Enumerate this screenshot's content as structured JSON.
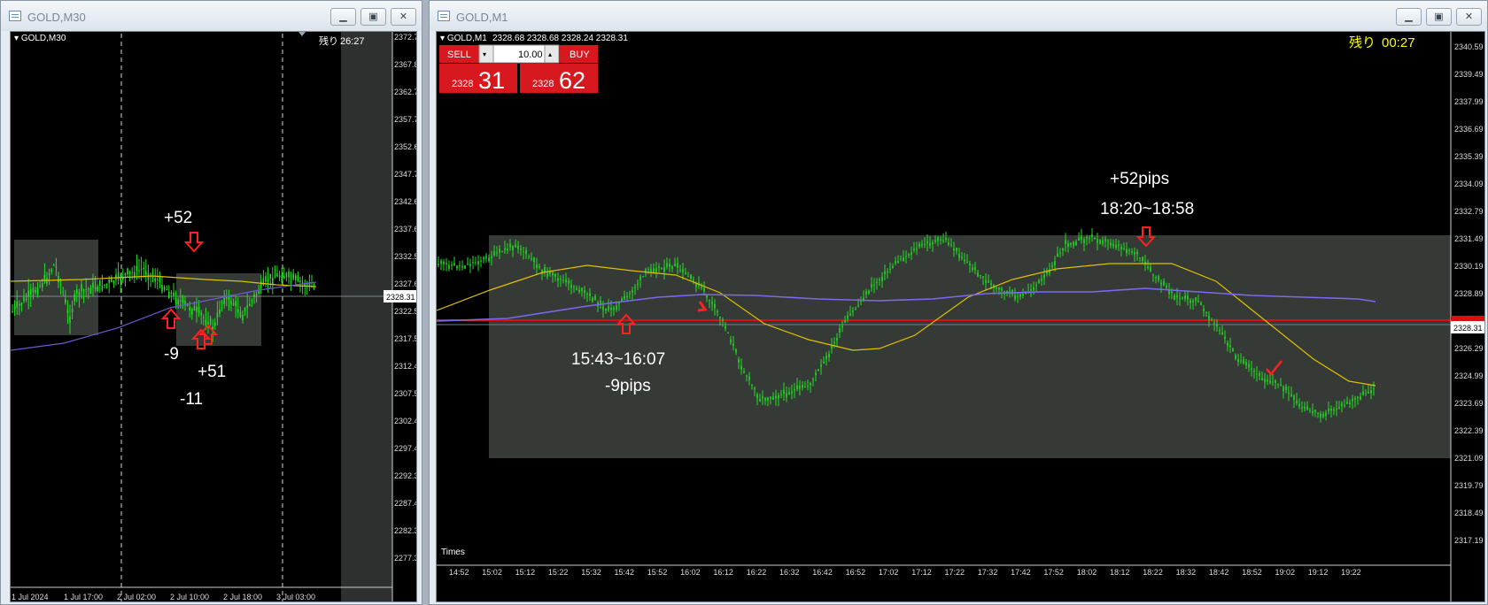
{
  "left": {
    "window_title": "GOLD,M30",
    "header_label": "GOLD,M30",
    "remain_label": "残り",
    "remain_time": "26:27",
    "price_labels": [
      "2372.78",
      "2367.83",
      "2362.73",
      "2357.78",
      "2352.68",
      "2347.73",
      "2342.63",
      "2337.68",
      "2332.58",
      "2327.63",
      "2322.53",
      "2317.58",
      "2312.48",
      "2307.53",
      "2302.43",
      "2297.48",
      "2292.38",
      "2287.43",
      "2282.33",
      "2277.38"
    ],
    "current_price": "2328.31",
    "time_labels": [
      "1 Jul 2024",
      "1 Jul 17:00",
      "2 Jul 02:00",
      "2 Jul 10:00",
      "2 Jul 18:00",
      "3 Jul 03:00"
    ],
    "annotations": {
      "a1": "+52",
      "a2": "-9",
      "a3": "+51",
      "a4": "-11"
    }
  },
  "right": {
    "window_title": "GOLD,M1",
    "header_label": "GOLD,M1",
    "ohlc": "2328.68 2328.68 2328.24 2328.31",
    "remain_label": "残り",
    "remain_time": "00:27",
    "trade": {
      "sell_label": "SELL",
      "buy_label": "BUY",
      "lot": "10.00",
      "sell_small": "2328",
      "sell_big": "31",
      "buy_small": "2328",
      "buy_big": "62"
    },
    "price_labels": [
      "2340.59",
      "2339.49",
      "2337.99",
      "2336.69",
      "2335.39",
      "2334.09",
      "2332.79",
      "2331.49",
      "2330.19",
      "2328.89",
      "2327.59",
      "2326.29",
      "2324.99",
      "2323.69",
      "2322.39",
      "2321.09",
      "2319.79",
      "2318.49",
      "2317.19"
    ],
    "current_price": "2328.31",
    "time_labels": [
      "14:52",
      "15:02",
      "15:12",
      "15:22",
      "15:32",
      "15:42",
      "15:52",
      "16:02",
      "16:12",
      "16:22",
      "16:32",
      "16:42",
      "16:52",
      "17:02",
      "17:12",
      "17:22",
      "17:32",
      "17:42",
      "17:52",
      "18:02",
      "18:12",
      "18:22",
      "18:32",
      "18:42",
      "18:52",
      "19:02",
      "19:12",
      "19:22"
    ],
    "times_tab": "Times",
    "annotations": {
      "a1": "+52pips",
      "a2": "18:20~18:58",
      "a3": "15:43~16:07",
      "a4": "-9pips"
    }
  },
  "colors": {
    "candle": "#22dd22",
    "ma_fast": "#e0c000",
    "ma_slow": "#6a5acd",
    "price_line": "#d81010",
    "zone": "#353a37",
    "sell": "#d7191f",
    "buy": "#d7191f",
    "annotation": "#ffffff",
    "arrow": "#ff2020"
  }
}
